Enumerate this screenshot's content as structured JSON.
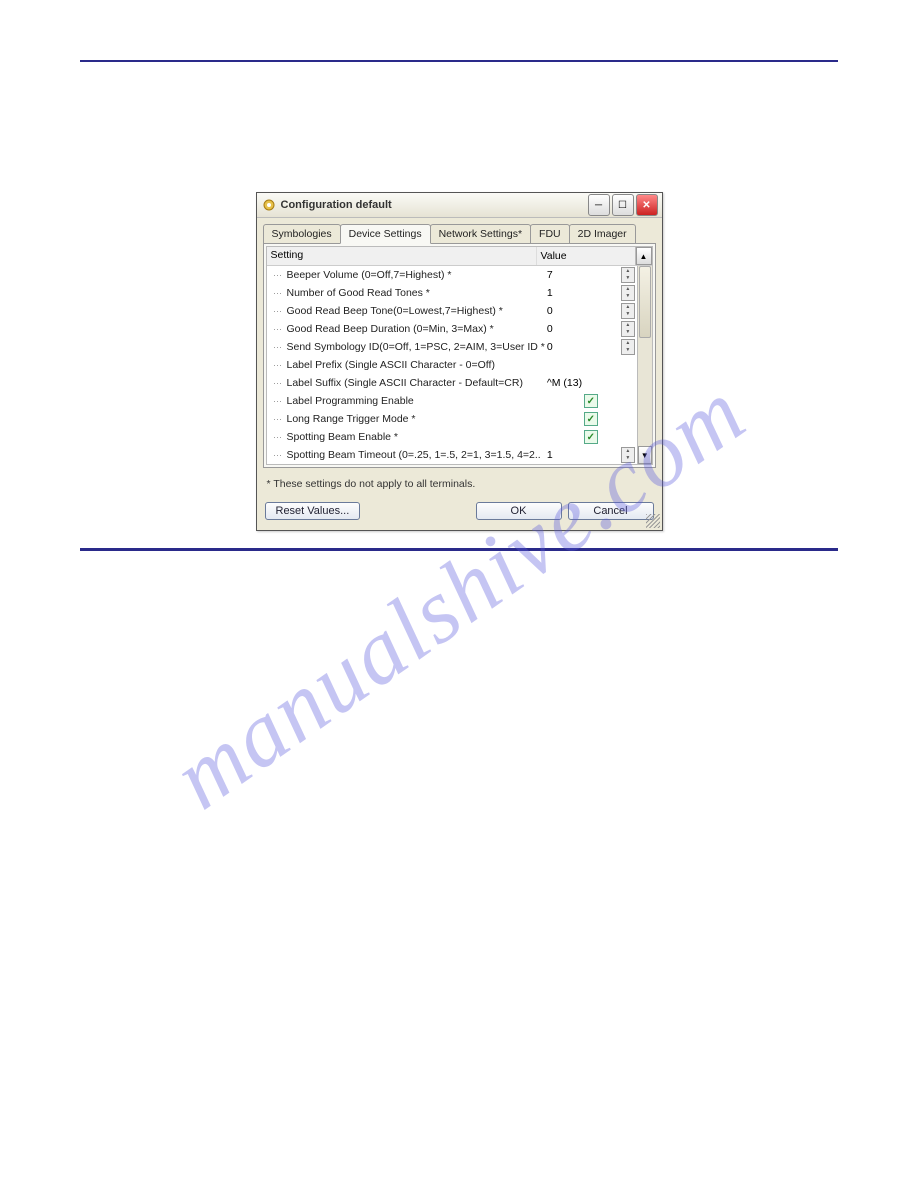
{
  "watermark": "manualshive.com",
  "dialog": {
    "title": "Configuration default",
    "tabs": [
      "Symbologies",
      "Device Settings",
      "Network Settings*",
      "FDU",
      "2D Imager"
    ],
    "active_tab": 1,
    "columns": {
      "setting": "Setting",
      "value": "Value"
    },
    "rows": [
      {
        "label": "Beeper Volume (0=Off,7=Highest) *",
        "value": "7",
        "type": "spin"
      },
      {
        "label": "Number of Good Read Tones *",
        "value": "1",
        "type": "spin"
      },
      {
        "label": "Good Read Beep Tone(0=Lowest,7=Highest) *",
        "value": "0",
        "type": "spin"
      },
      {
        "label": "Good Read Beep Duration (0=Min, 3=Max) *",
        "value": "0",
        "type": "spin"
      },
      {
        "label": "Send Symbology ID(0=Off, 1=PSC, 2=AIM, 3=User ID *",
        "value": "0",
        "type": "spin"
      },
      {
        "label": "Label Prefix (Single ASCII Character - 0=Off)",
        "value": "",
        "type": "text"
      },
      {
        "label": "Label Suffix (Single ASCII Character - Default=CR)",
        "value": "^M (13)",
        "type": "text"
      },
      {
        "label": "Label Programming Enable",
        "value": "",
        "type": "check"
      },
      {
        "label": "Long Range Trigger Mode *",
        "value": "",
        "type": "check"
      },
      {
        "label": "Spotting Beam Enable *",
        "value": "",
        "type": "check"
      },
      {
        "label": "Spotting Beam Timeout (0=.25, 1=.5, 2=1, 3=1.5, 4=2..",
        "value": "1",
        "type": "spin"
      }
    ],
    "footnote": "* These settings do not apply to all terminals.",
    "buttons": {
      "reset": "Reset Values...",
      "ok": "OK",
      "cancel": "Cancel"
    }
  }
}
